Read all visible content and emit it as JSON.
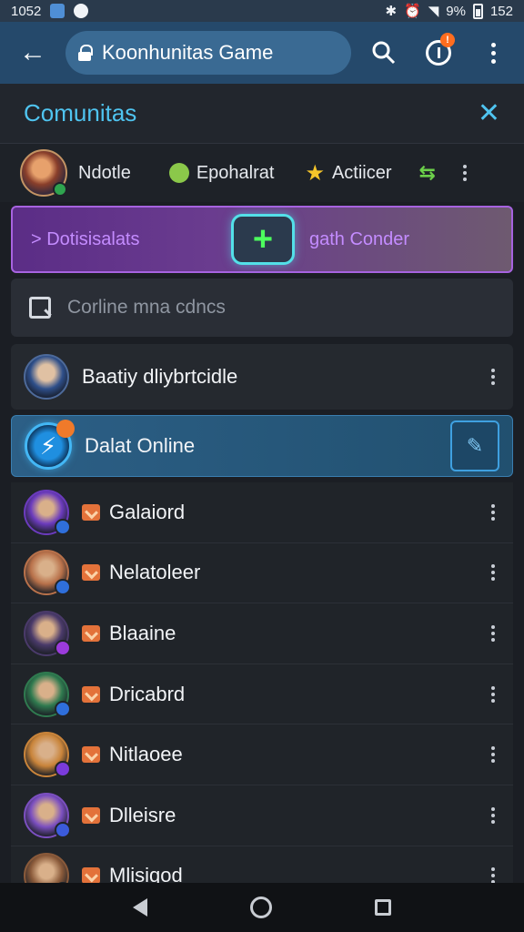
{
  "status_bar": {
    "time": "1052",
    "battery": "9%",
    "clock_right": "152"
  },
  "toolbar": {
    "url_text": "Koonhunitas Game",
    "tab_badge": "!"
  },
  "panel": {
    "title": "Comunitas"
  },
  "filters": [
    {
      "label": "Ndotle"
    },
    {
      "label": "Epohalrat"
    },
    {
      "label": "Actiicer"
    }
  ],
  "promo": {
    "left_text": "> Dotisisalats",
    "right_text": "gath Conder"
  },
  "search": {
    "placeholder": "Corline mna cdncs"
  },
  "list": {
    "first": {
      "name": "Baatiy dliybrtcidle"
    },
    "selected": {
      "name": "Dalat Online"
    },
    "items": [
      {
        "name": "Galaiord",
        "avatar_color": "#6b3bbd",
        "mini_color": "#2f6fdb"
      },
      {
        "name": "Nelatoleer",
        "avatar_color": "#b8714a",
        "mini_color": "#2f6fdb"
      },
      {
        "name": "Blaaine",
        "avatar_color": "#4a3a6a",
        "mini_color": "#9b3bdb"
      },
      {
        "name": "Dricabrd",
        "avatar_color": "#2f7a4f",
        "mini_color": "#2f6fdb"
      },
      {
        "name": "Nitlaoee",
        "avatar_color": "#c9843a",
        "mini_color": "#7a3bdb"
      },
      {
        "name": "Dlleisre",
        "avatar_color": "#7b4fc0",
        "mini_color": "#3b5bdb"
      },
      {
        "name": "Mlisiqod",
        "avatar_color": "#8a5a3a",
        "mini_color": "#2f6fdb"
      }
    ]
  }
}
